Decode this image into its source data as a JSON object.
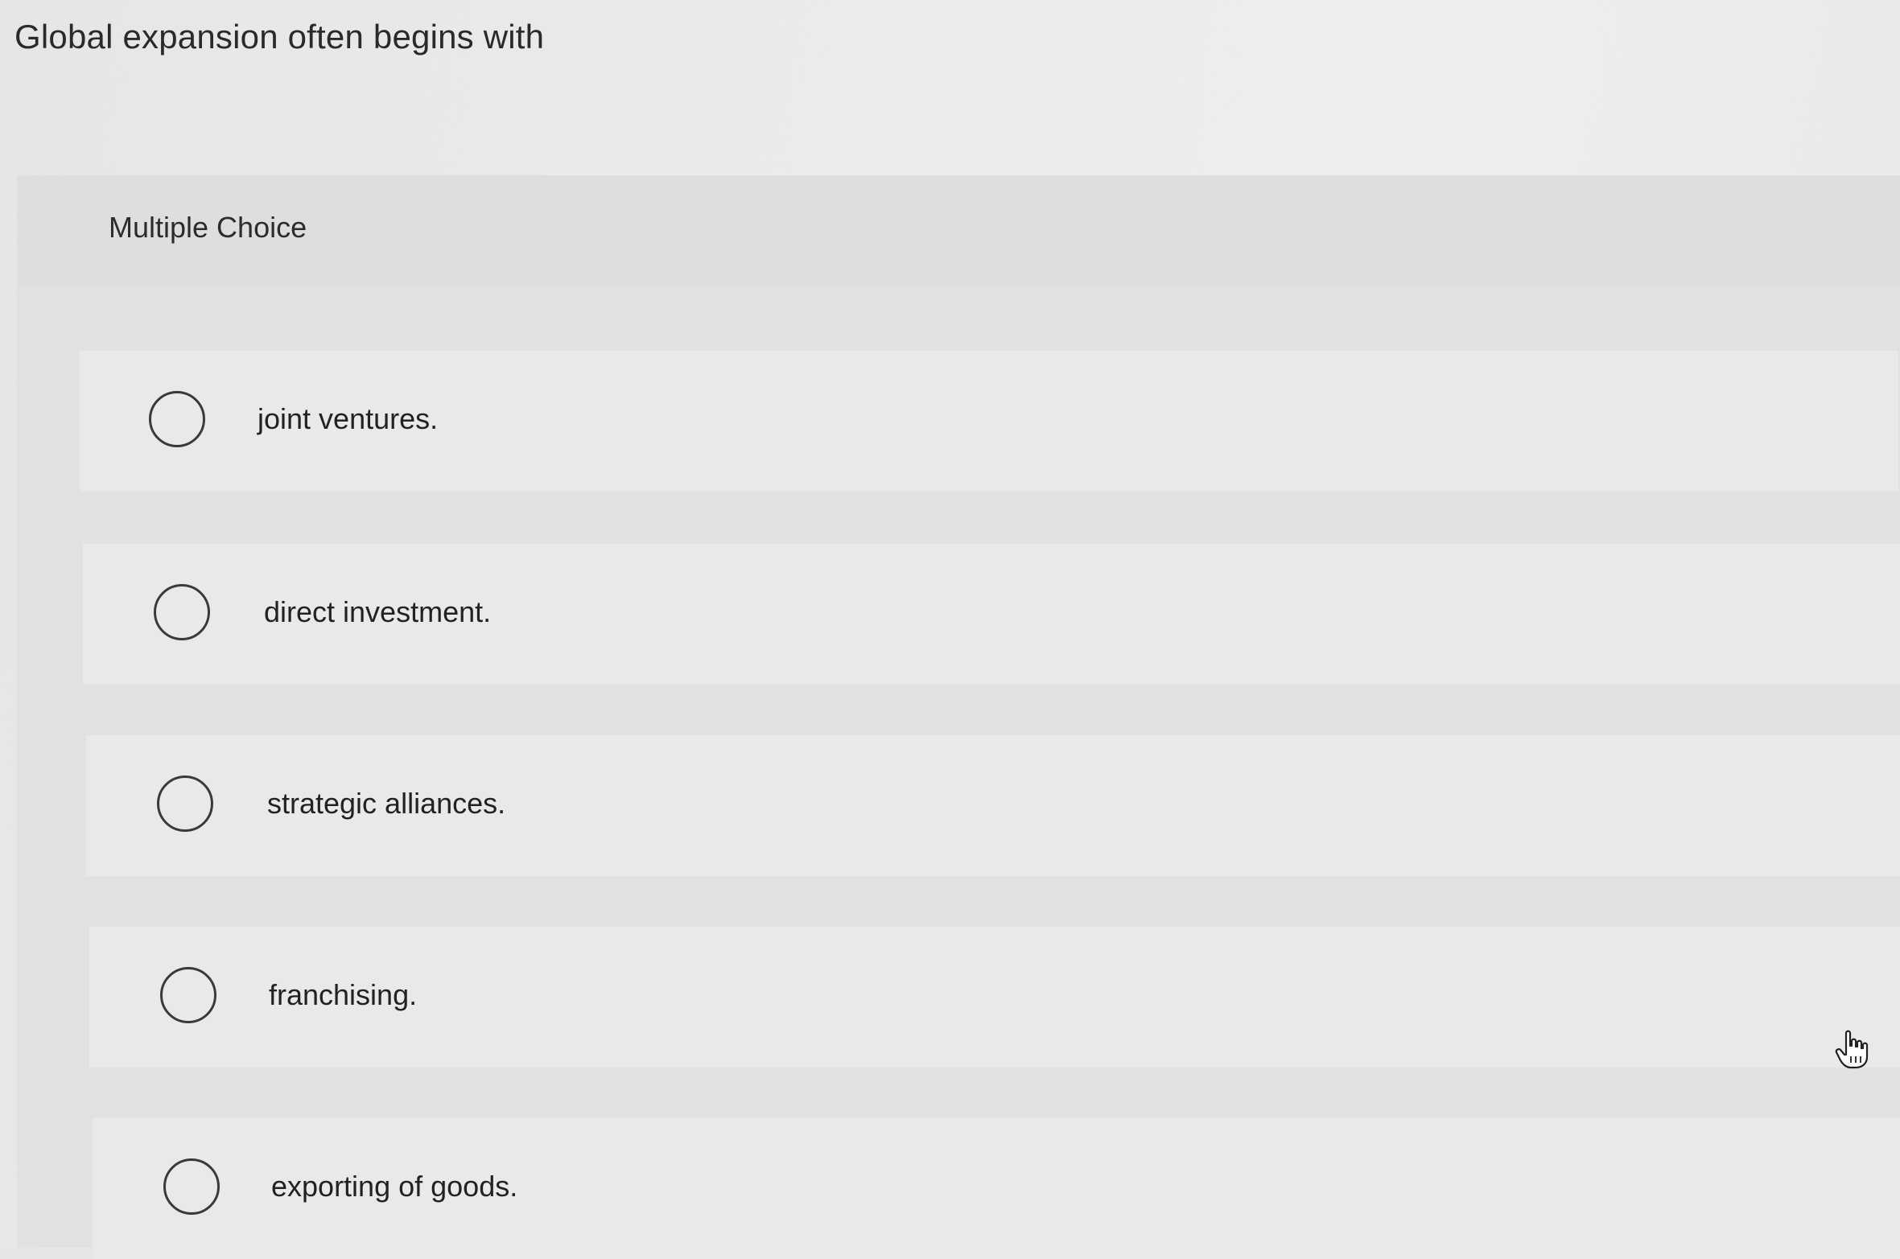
{
  "question": {
    "text": "Global expansion often begins with"
  },
  "panel": {
    "header_label": "Multiple Choice"
  },
  "options": [
    {
      "label": "joint ventures."
    },
    {
      "label": "direct investment."
    },
    {
      "label": "strategic alliances."
    },
    {
      "label": "franchising."
    },
    {
      "label": "exporting of goods."
    }
  ],
  "cursor": {
    "icon": "hand-pointer-icon"
  }
}
